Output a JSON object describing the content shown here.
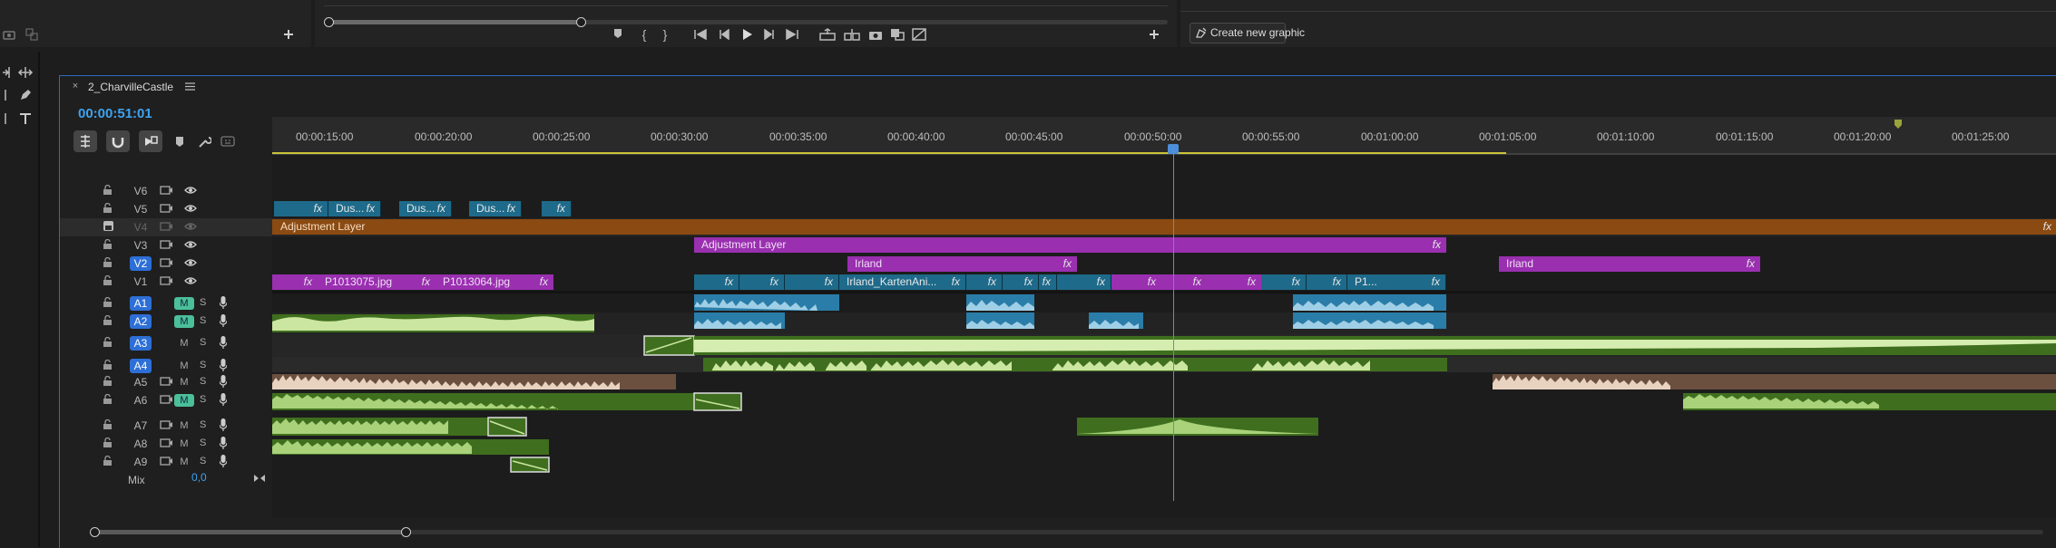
{
  "app": {
    "accent": "#2d8ceb",
    "playhead_color": "#5b8fd6"
  },
  "graphics_panel": {
    "create_button": "Create new graphic"
  },
  "sequence": {
    "tab_name": "2_CharvilleCastle",
    "timecode": "00:00:51:01",
    "mix_label": "Mix",
    "mix_value": "0,0"
  },
  "ruler": {
    "labels": [
      "00:00:15:00",
      "00:00:20:00",
      "00:00:25:00",
      "00:00:30:00",
      "00:00:35:00",
      "00:00:40:00",
      "00:00:45:00",
      "00:00:50:00",
      "00:00:55:00",
      "00:01:00:00",
      "00:01:05:00",
      "00:01:10:00",
      "00:01:15:00",
      "00:01:20:00",
      "00:01:25:00"
    ]
  },
  "video_tracks": [
    {
      "name": "V6",
      "targeted": false
    },
    {
      "name": "V5",
      "targeted": false
    },
    {
      "name": "V4",
      "targeted": false,
      "locked": true
    },
    {
      "name": "V3",
      "targeted": false
    },
    {
      "name": "V2",
      "targeted": true
    },
    {
      "name": "V1",
      "targeted": false
    }
  ],
  "audio_tracks": [
    {
      "name": "A1",
      "targeted": true,
      "mute": true
    },
    {
      "name": "A2",
      "targeted": true,
      "mute": true
    },
    {
      "name": "A3",
      "targeted": true,
      "mute": false
    },
    {
      "name": "A4",
      "targeted": true,
      "mute": false
    },
    {
      "name": "A5",
      "targeted": false,
      "mute": false
    },
    {
      "name": "A6",
      "targeted": false,
      "mute": true
    },
    {
      "name": "A7",
      "targeted": false,
      "mute": false
    },
    {
      "name": "A8",
      "targeted": false,
      "mute": false
    },
    {
      "name": "A9",
      "targeted": false,
      "mute": false
    }
  ],
  "clips": {
    "v5": [
      "Dus...",
      "Dus...",
      "Dus..."
    ],
    "v4_adjustment": "Adjustment Layer",
    "v3_adjustment": "Adjustment Layer",
    "v2_irland_1": "Irland",
    "v2_irland_2": "Irland",
    "v1_p1": "P1013075.jpg",
    "v1_p2": "P1013064.jpg",
    "v1_irland": "Irland_KartenAni...",
    "v1_p3": "P1...",
    "fx": "fx"
  }
}
